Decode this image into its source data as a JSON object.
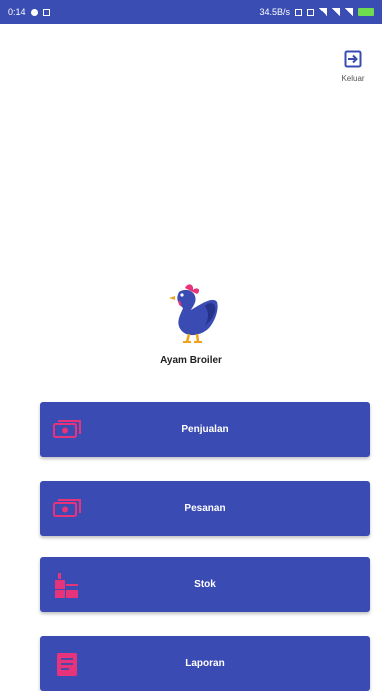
{
  "status_bar": {
    "time": "0:14",
    "network_speed": "34.5B/s"
  },
  "header": {
    "logout_label": "Keluar",
    "logout_icon": "logout-icon"
  },
  "app": {
    "name": "Ayam Broiler",
    "logo_icon": "rooster-icon"
  },
  "menu": {
    "items": [
      {
        "label": "Penjualan",
        "icon": "cash-icon"
      },
      {
        "label": "Pesanan",
        "icon": "cash-icon"
      },
      {
        "label": "Stok",
        "icon": "stock-icon"
      },
      {
        "label": "Laporan",
        "icon": "report-icon"
      }
    ]
  },
  "colors": {
    "primary": "#3a4bb4",
    "icon_accent": "#e6337a",
    "status_bar": "#3a4db3"
  }
}
